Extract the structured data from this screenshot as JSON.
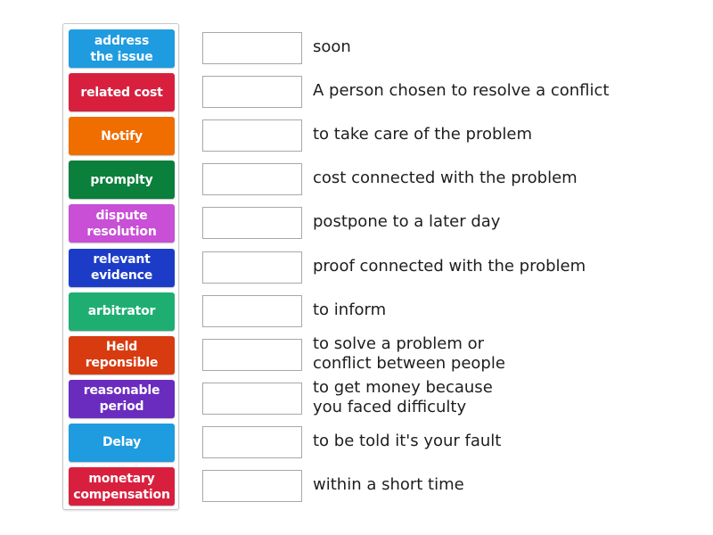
{
  "activity": {
    "type": "match-up",
    "tiles": [
      {
        "label": "address\nthe issue",
        "color": "#1f9be0"
      },
      {
        "label": "related cost",
        "color": "#d8203e"
      },
      {
        "label": "Notify",
        "color": "#f06d00"
      },
      {
        "label": "promplty",
        "color": "#0b7f3c"
      },
      {
        "label": "dispute\nresolution",
        "color": "#c84fd6"
      },
      {
        "label": "relevant\nevidence",
        "color": "#1c3cc8"
      },
      {
        "label": "arbitrator",
        "color": "#1fae72"
      },
      {
        "label": "Held\nreponsible",
        "color": "#d83b10"
      },
      {
        "label": "reasonable\nperiod",
        "color": "#6a2cbf"
      },
      {
        "label": "Delay",
        "color": "#1f9be0"
      },
      {
        "label": "monetary\ncompensation",
        "color": "#d8203e"
      }
    ],
    "definitions": [
      {
        "text": "soon",
        "answer": ""
      },
      {
        "text": "A person chosen to resolve a conflict",
        "answer": ""
      },
      {
        "text": "to take care of the problem",
        "answer": ""
      },
      {
        "text": "cost connected with the problem",
        "answer": ""
      },
      {
        "text": "postpone to a later day",
        "answer": ""
      },
      {
        "text": "proof connected with the problem",
        "answer": ""
      },
      {
        "text": "to inform",
        "answer": ""
      },
      {
        "text": "to solve a problem or\nconflict between people",
        "answer": ""
      },
      {
        "text": "to get money because\nyou faced difficulty",
        "answer": ""
      },
      {
        "text": "to be told it's your fault",
        "answer": ""
      },
      {
        "text": "within a short time",
        "answer": ""
      }
    ]
  }
}
